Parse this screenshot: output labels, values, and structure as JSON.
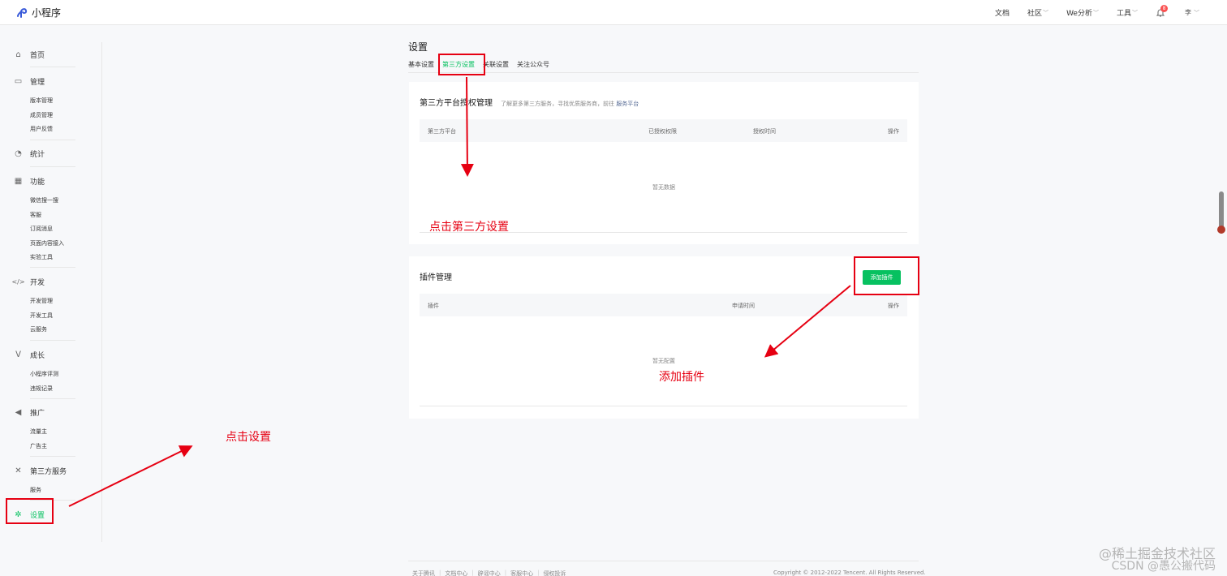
{
  "app": {
    "title": "小程序"
  },
  "topnav": {
    "docs": "文档",
    "community": "社区",
    "we_analysis": "We分析",
    "tools": "工具",
    "bell_count": "8",
    "avatar": "李"
  },
  "sidebar": {
    "home": "首页",
    "manage": {
      "label": "管理",
      "items": [
        "版本管理",
        "成员管理",
        "用户反馈"
      ]
    },
    "stats": "统计",
    "features": {
      "label": "功能",
      "items": [
        "微信搜一搜",
        "客服",
        "订阅消息",
        "页面内容接入",
        "实验工具"
      ]
    },
    "dev": {
      "label": "开发",
      "items": [
        "开发管理",
        "开发工具",
        "云服务"
      ]
    },
    "growth": {
      "label": "成长",
      "items": [
        "小程序评测",
        "违规记录"
      ]
    },
    "promote": {
      "label": "推广",
      "items": [
        "流量主",
        "广告主"
      ]
    },
    "third_party": {
      "label": "第三方服务",
      "items": [
        "服务"
      ]
    },
    "settings": "设置"
  },
  "main": {
    "page_title": "设置",
    "tabs": [
      "基本设置",
      "第三方设置",
      "关联设置",
      "关注公众号"
    ],
    "auth_card": {
      "title": "第三方平台授权管理",
      "desc": "了解更多第三方服务，寻找优质服务商，前往",
      "desc_link": "服务平台",
      "columns": [
        "第三方平台",
        "已授权权限",
        "授权时间",
        "操作"
      ],
      "empty": "暂无数据"
    },
    "plugin_card": {
      "title": "插件管理",
      "add_button": "添加插件",
      "columns": [
        "插件",
        "申请时间",
        "操作"
      ],
      "empty": "暂无配置"
    }
  },
  "footer": {
    "links": [
      "关于腾讯",
      "文档中心",
      "辟谣中心",
      "客服中心",
      "侵权投诉"
    ],
    "copyright": "Copyright © 2012-2022 Tencent. All Rights Reserved."
  },
  "annotations": {
    "click_third_party": "点击第三方设置",
    "add_plugin": "添加插件",
    "click_settings": "点击设置"
  },
  "watermark": {
    "line1": "@稀土掘金技术社区",
    "line2": "CSDN @愚公搬代码"
  },
  "colors": {
    "accent": "#07c160",
    "annotation": "#e60012",
    "link": "#576b95"
  }
}
